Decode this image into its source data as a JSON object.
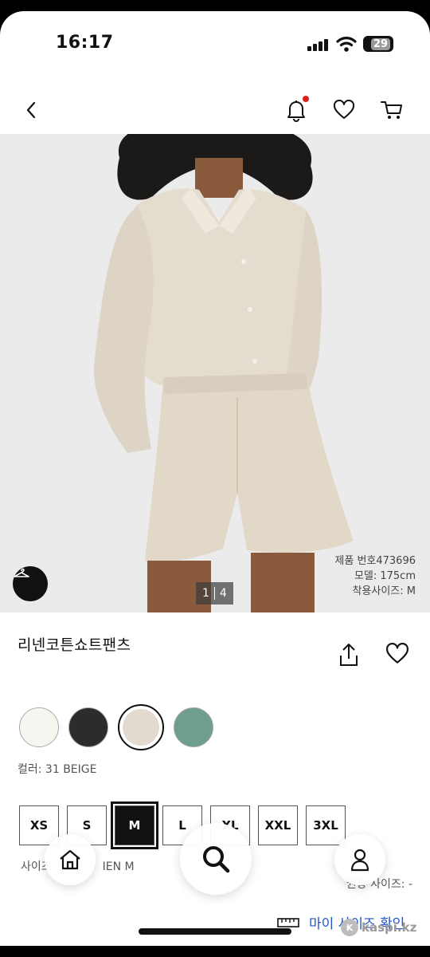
{
  "status_bar": {
    "time": "16:17",
    "battery": "29"
  },
  "nav": {
    "back_icon": "chevron-left-icon",
    "notification_icon": "bell-icon",
    "wishlist_icon": "heart-icon",
    "cart_icon": "cart-icon",
    "notification_dot_color": "#e0201b"
  },
  "gallery": {
    "current_page": "1",
    "total_pages": "4",
    "model_info": [
      "제품 번호473696",
      "모델: 175cm",
      "착용사이즈: M"
    ]
  },
  "product": {
    "title": "리넨코튼쇼트팬츠"
  },
  "colors": {
    "swatches": [
      {
        "color": "#f7f5f0",
        "selected": false
      },
      {
        "color": "#2b2c2e",
        "selected": false
      },
      {
        "color": "#e3dbd0",
        "selected": true
      },
      {
        "color": "#6f9e8c",
        "selected": false
      }
    ],
    "label": "컬러: 31 BEIGE"
  },
  "sizes": {
    "options": [
      "XS",
      "S",
      "M",
      "L",
      "XL",
      "XXL",
      "3XL"
    ],
    "selected": "M",
    "label_prefix": "사이즈",
    "label_suffix": "IEN M",
    "recommended_label": "권장 사이즈: -"
  },
  "my_size_link": "마이 사이즈 확인",
  "watermark": "kaspi.kz"
}
